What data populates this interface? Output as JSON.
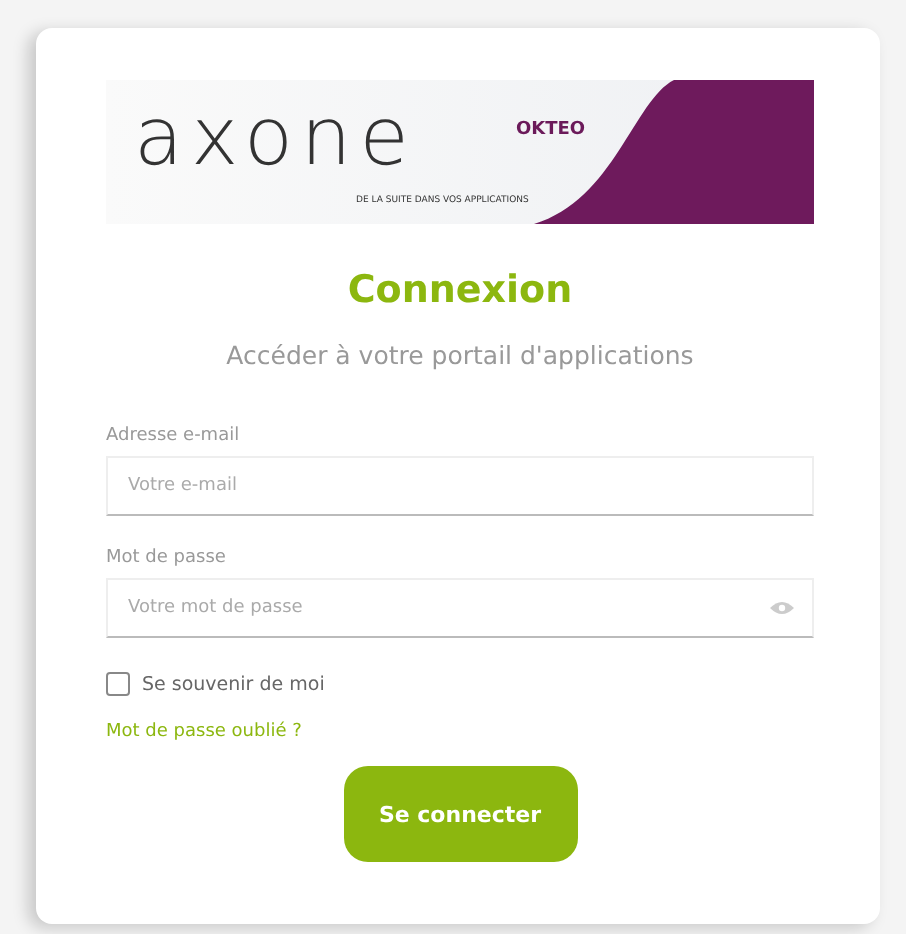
{
  "logo": {
    "wordmark": "axone",
    "brand": "OKTEO",
    "tagline": "DE LA SUITE DANS VOS APPLICATIONS"
  },
  "title": "Connexion",
  "subtitle": "Accéder à votre portail d'applications",
  "fields": [
    {
      "label": "Adresse e-mail",
      "placeholder": "Votre e-mail",
      "kind": "email"
    },
    {
      "label": "Mot de passe",
      "placeholder": "Votre mot de passe",
      "kind": "password"
    }
  ],
  "remember": {
    "label": "Se souvenir de moi",
    "checked": false
  },
  "forgot_link": "Mot de passe oublié ?",
  "submit": "Se connecter"
}
